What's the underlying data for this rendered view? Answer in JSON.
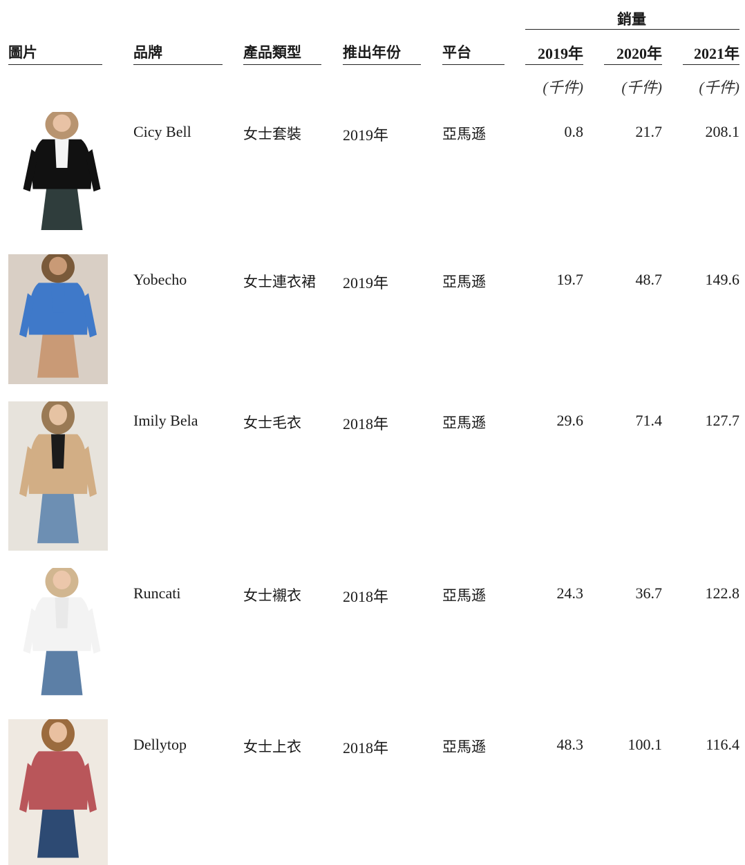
{
  "header": {
    "group_label": "銷量",
    "col_image": "圖片",
    "col_brand": "品牌",
    "col_type": "產品類型",
    "col_year": "推出年份",
    "col_platform": "平台",
    "years": [
      "2019年",
      "2020年",
      "2021年"
    ],
    "unit": "(千件)"
  },
  "rows": [
    {
      "brand": "Cicy Bell",
      "type": "女士套裝",
      "launch": "2019年",
      "platform": "亞馬遜",
      "s2019": "0.8",
      "s2020": "21.7",
      "s2021": "208.1",
      "photo": {
        "bg": "#ffffff",
        "top": "#111111",
        "inner": "#f4f4f4",
        "hair": "#b89470",
        "skin": "#e8c2a5",
        "pants": "#2f3d3c"
      }
    },
    {
      "brand": "Yobecho",
      "type": "女士連衣裙",
      "launch": "2019年",
      "platform": "亞馬遜",
      "s2019": "19.7",
      "s2020": "48.7",
      "s2021": "149.6",
      "photo": {
        "bg": "#d9cfc5",
        "top": "#3f79c9",
        "inner": "#3f79c9",
        "hair": "#7a5a3a",
        "skin": "#c99a76",
        "pants": "#c99a76"
      }
    },
    {
      "brand": "Imily Bela",
      "type": "女士毛衣",
      "launch": "2018年",
      "platform": "亞馬遜",
      "s2019": "29.6",
      "s2020": "71.4",
      "s2021": "127.7",
      "photo": {
        "bg": "#e7e3dc",
        "top": "#d2ae85",
        "inner": "#1b1b1b",
        "hair": "#9a7a55",
        "skin": "#e6c3a3",
        "pants": "#6d8fb3"
      }
    },
    {
      "brand": "Runcati",
      "type": "女士襯衣",
      "launch": "2018年",
      "platform": "亞馬遜",
      "s2019": "24.3",
      "s2020": "36.7",
      "s2021": "122.8",
      "photo": {
        "bg": "#ffffff",
        "top": "#f3f3f3",
        "inner": "#e9e9e9",
        "hair": "#d1b690",
        "skin": "#ecc7ab",
        "pants": "#5c7fa6"
      }
    },
    {
      "brand": "Dellytop",
      "type": "女士上衣",
      "launch": "2018年",
      "platform": "亞馬遜",
      "s2019": "48.3",
      "s2020": "100.1",
      "s2021": "116.4",
      "photo": {
        "bg": "#efe9e1",
        "top": "#b9565a",
        "inner": "#b9565a",
        "hair": "#9b6b3e",
        "skin": "#e9c0a0",
        "pants": "#2d4a73"
      }
    }
  ]
}
